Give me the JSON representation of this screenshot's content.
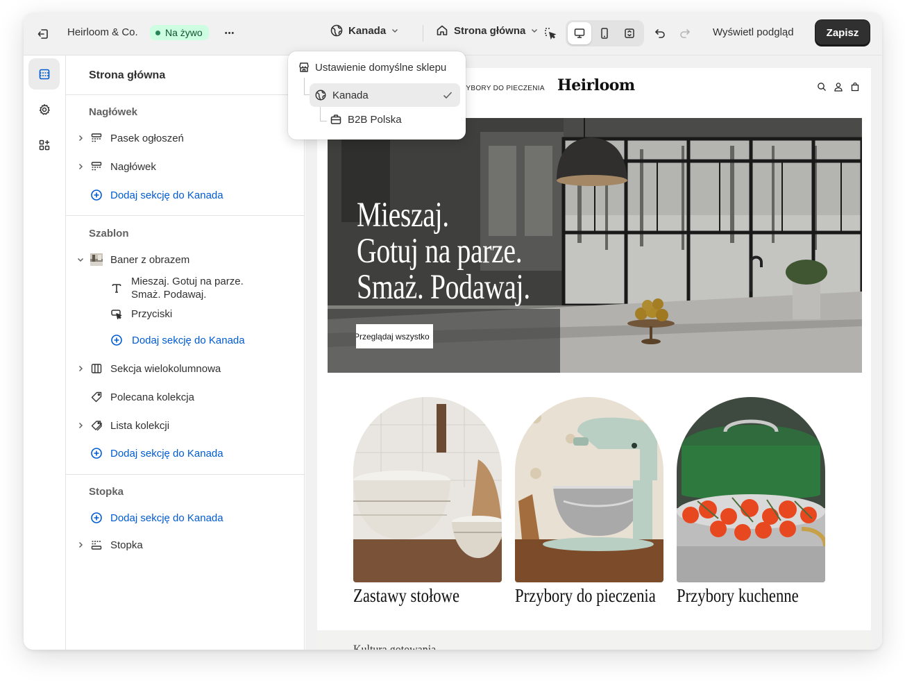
{
  "topbar": {
    "store_name": "Heirloom & Co.",
    "live_badge": "Na żywo",
    "more": "•••",
    "market": "Kanada",
    "page": "Strona główna",
    "preview": "Wyświetl podgląd",
    "save": "Zapisz"
  },
  "market_dropdown": {
    "default": "Ustawienie domyślne sklepu",
    "items": [
      {
        "label": "Kanada",
        "selected": true
      },
      {
        "label": "B2B Polska",
        "selected": false
      }
    ]
  },
  "sidebar": {
    "title": "Strona główna",
    "header_group": {
      "label": "Nagłówek",
      "items": [
        "Pasek ogłoszeń",
        "Nagłówek"
      ],
      "add": "Dodaj sekcję do Kanada"
    },
    "template_group": {
      "label": "Szablon",
      "banner": "Baner z obrazem",
      "banner_blocks": [
        "Mieszaj. Gotuj na parze.",
        "Smaż. Podawaj.",
        "Przyciski"
      ],
      "banner_add": "Dodaj sekcję do Kanada",
      "items": [
        "Sekcja wielokolumnowa",
        "Polecana kolekcja",
        "Lista kolekcji"
      ],
      "add": "Dodaj sekcję do Kanada"
    },
    "footer_group": {
      "label": "Stopka",
      "add": "Dodaj sekcję do Kanada",
      "item": "Stopka"
    }
  },
  "preview": {
    "nav_text": "ZYBORY DO PIECZENIA",
    "logo": "Heirloom",
    "hero_lines": [
      "Mieszaj.",
      "Gotuj na parze.",
      "Smaż. Podawaj."
    ],
    "hero_button": "Przeglądaj wszystko",
    "collections": [
      "Zastawy stołowe",
      "Przybory do pieczenia",
      "Przybory kuchenne"
    ],
    "culture": "Kultura gotowania"
  }
}
